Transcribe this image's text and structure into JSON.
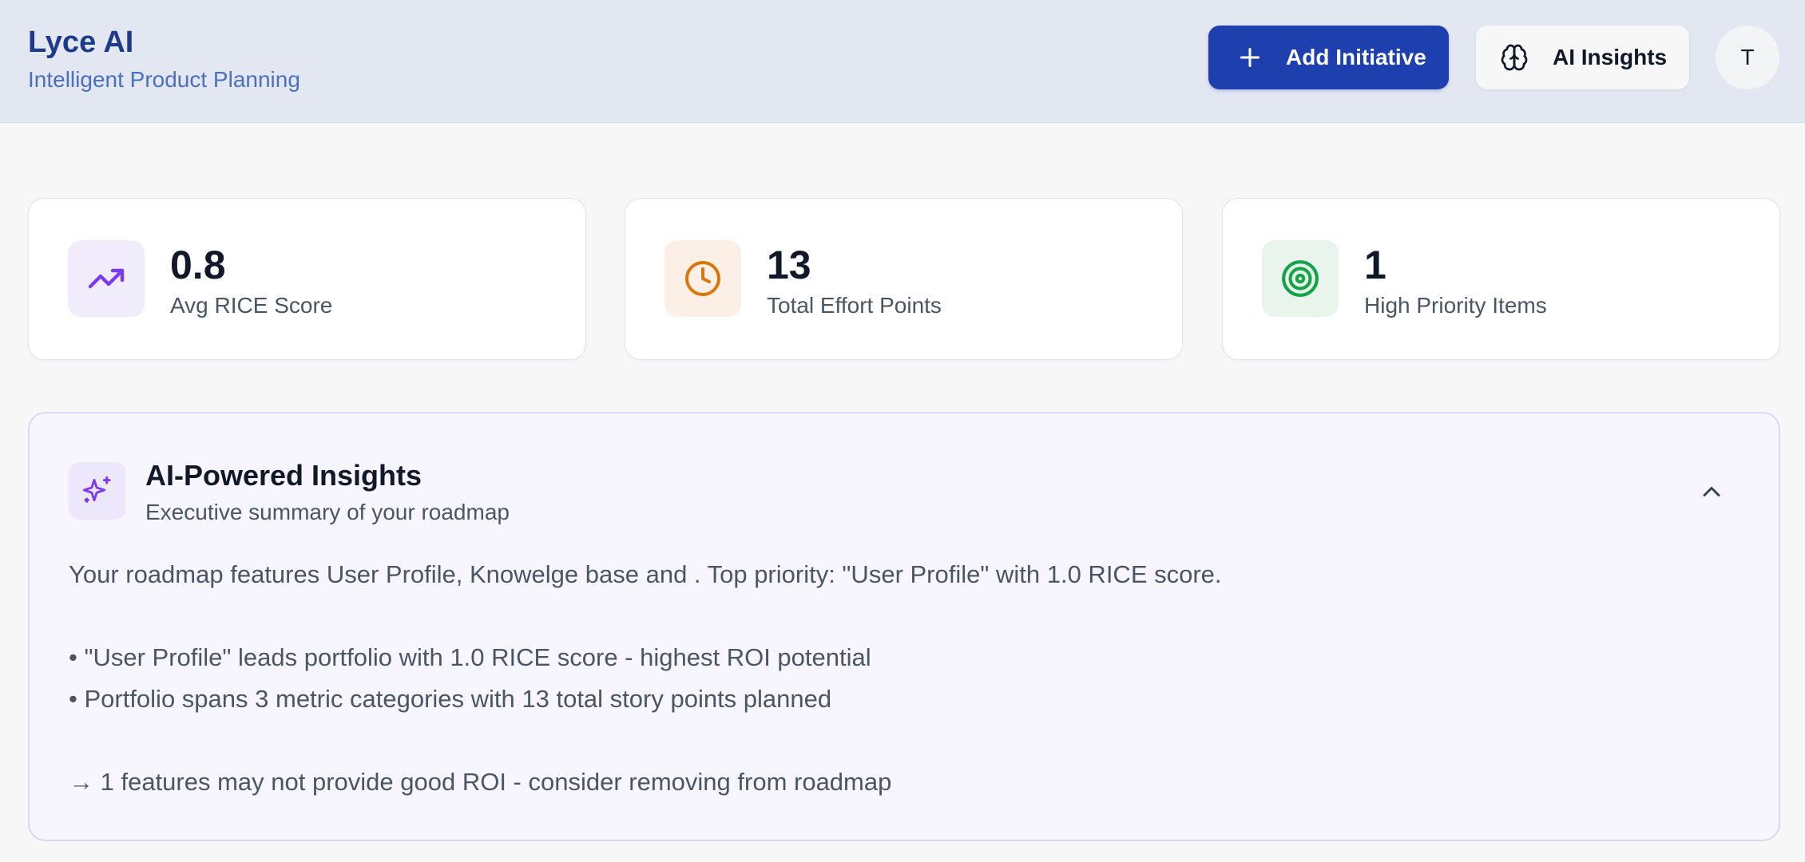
{
  "header": {
    "title": "Lyce AI",
    "subtitle": "Intelligent Product Planning",
    "add_button": "Add Initiative",
    "insights_button": "AI Insights",
    "avatar_initial": "T"
  },
  "stats": [
    {
      "value": "0.8",
      "label": "Avg RICE Score",
      "icon": "trending-up-icon",
      "color": "#7c3aed",
      "bg": "#f1ecfb"
    },
    {
      "value": "13",
      "label": "Total Effort Points",
      "icon": "clock-icon",
      "color": "#d97706",
      "bg": "#fbefe6"
    },
    {
      "value": "1",
      "label": "High Priority Items",
      "icon": "target-icon",
      "color": "#16a34a",
      "bg": "#e9f5ec"
    }
  ],
  "insights": {
    "title": "AI-Powered Insights",
    "subtitle": "Executive summary of your roadmap",
    "summary": "Your roadmap features User Profile, Knowelge base and . Top priority: \"User Profile\" with 1.0 RICE score.",
    "bullets": [
      "• \"User Profile\" leads portfolio with 1.0 RICE score - highest ROI potential",
      "• Portfolio spans 3 metric categories with 13 total story points planned"
    ],
    "recommendation": "→ 1 features may not provide good ROI - consider removing from roadmap"
  },
  "colors": {
    "accent": "#1e40af",
    "brand": "#1e3a8a",
    "insights_accent": "#7c3aed"
  }
}
